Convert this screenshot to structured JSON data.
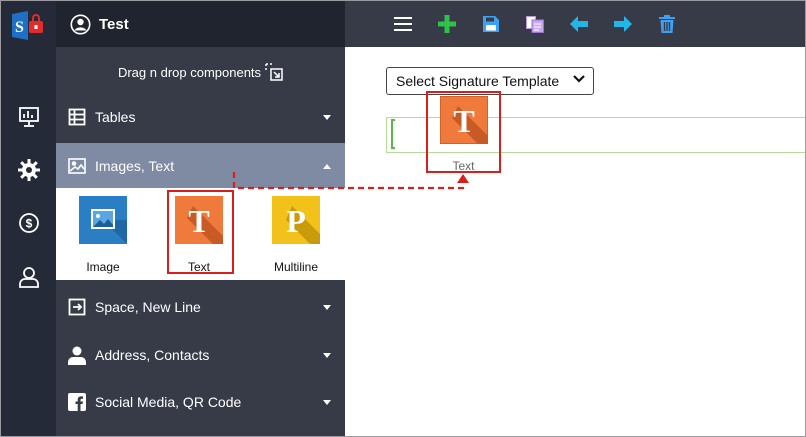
{
  "app": {
    "title": "Test"
  },
  "rail": {
    "icons": [
      "dashboard-icon",
      "settings-icon",
      "billing-icon",
      "user-icon"
    ]
  },
  "sidebar": {
    "drag_hint": "Drag n drop components",
    "sections": [
      {
        "label": "Tables",
        "icon": "table-icon",
        "expanded": false
      },
      {
        "label": "Images, Text",
        "icon": "image-icon",
        "expanded": true
      },
      {
        "label": "Space, New Line",
        "icon": "arrow-box-icon",
        "expanded": false
      },
      {
        "label": "Address, Contacts",
        "icon": "person-icon",
        "expanded": false
      },
      {
        "label": "Social Media, QR Code",
        "icon": "facebook-icon",
        "expanded": false
      }
    ],
    "components": [
      {
        "label": "Image",
        "icon": "image-tile-icon"
      },
      {
        "label": "Text",
        "icon": "text-tile-icon",
        "glyph": "T"
      },
      {
        "label": "Multiline",
        "icon": "multiline-tile-icon",
        "glyph": "P"
      }
    ]
  },
  "toolbar": {
    "buttons": [
      "menu-icon",
      "add-icon",
      "save-icon",
      "copy-icon",
      "back-icon",
      "forward-icon",
      "delete-icon"
    ]
  },
  "workspace": {
    "template_select": "Select Signature Template",
    "dragged_component": {
      "label": "Text",
      "glyph": "T"
    }
  },
  "colors": {
    "rail_bg": "#252a39",
    "sidebar_bg": "#363b47",
    "active_section_bg": "#7f8aa3",
    "highlight_red": "#d91e1e",
    "add_green": "#2ec24a",
    "nav_blue": "#22b5e8"
  }
}
